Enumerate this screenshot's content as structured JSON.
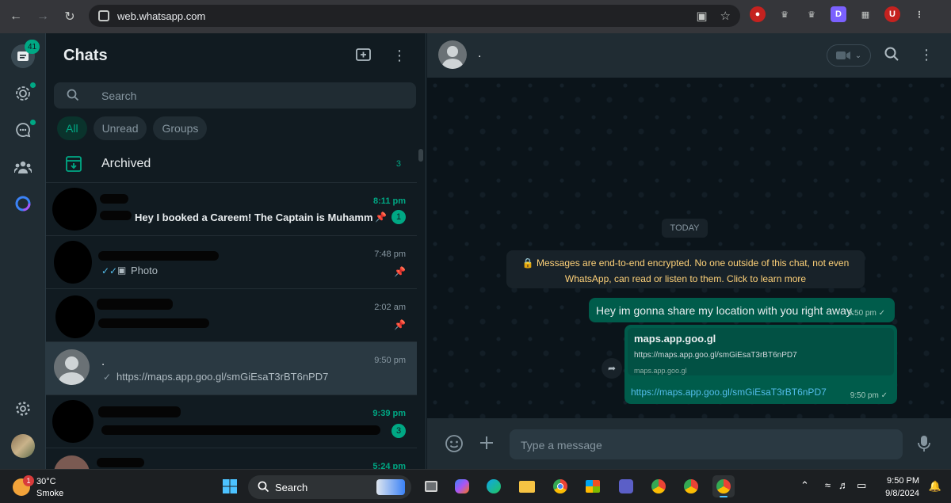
{
  "browser": {
    "url": "web.whatsapp.com",
    "profile_initial": "U"
  },
  "rail": {
    "chats_badge": "41"
  },
  "chatlist": {
    "title": "Chats",
    "search_placeholder": "Search",
    "filters": [
      "All",
      "Unread",
      "Groups"
    ],
    "archived_label": "Archived",
    "archived_count": "3",
    "rows": [
      {
        "time": "8:11 pm",
        "preview": "Hey I booked a Careem! The Captain is Muhamm...",
        "unread": "1"
      },
      {
        "time": "7:48 pm",
        "preview": "Photo"
      },
      {
        "time": "2:02 am"
      },
      {
        "name": ".",
        "time": "9:50 pm",
        "preview": "https://maps.app.goo.gl/smGiEsaT3rBT6nPD7"
      },
      {
        "time": "9:39 pm",
        "unread": "3"
      },
      {
        "time": "5:24 pm"
      }
    ]
  },
  "conversation": {
    "contact_name": ".",
    "day_label": "TODAY",
    "encryption_notice": "Messages are end-to-end encrypted. No one outside of this chat, not even WhatsApp, can read or listen to them. Click to learn more",
    "messages": [
      {
        "text": "Hey im gonna share my location with you right away.",
        "time": "9:50 pm"
      },
      {
        "link_title": "maps.app.goo.gl",
        "link_url": "https://maps.app.goo.gl/smGiEsaT3rBT6nPD7",
        "link_domain": "maps.app.goo.gl",
        "text": "https://maps.app.goo.gl/smGiEsaT3rBT6nPD7",
        "time": "9:50 pm"
      }
    ],
    "composer_placeholder": "Type a message"
  },
  "taskbar": {
    "weather_temp": "30°C",
    "weather_cond": "Smoke",
    "weather_badge": "1",
    "search_label": "Search",
    "time": "9:50 PM",
    "date": "9/8/2024"
  },
  "colors": {
    "accent": "#00a884",
    "outgoing_bubble": "#005c4b",
    "panel": "#202c33",
    "background": "#111b21"
  }
}
